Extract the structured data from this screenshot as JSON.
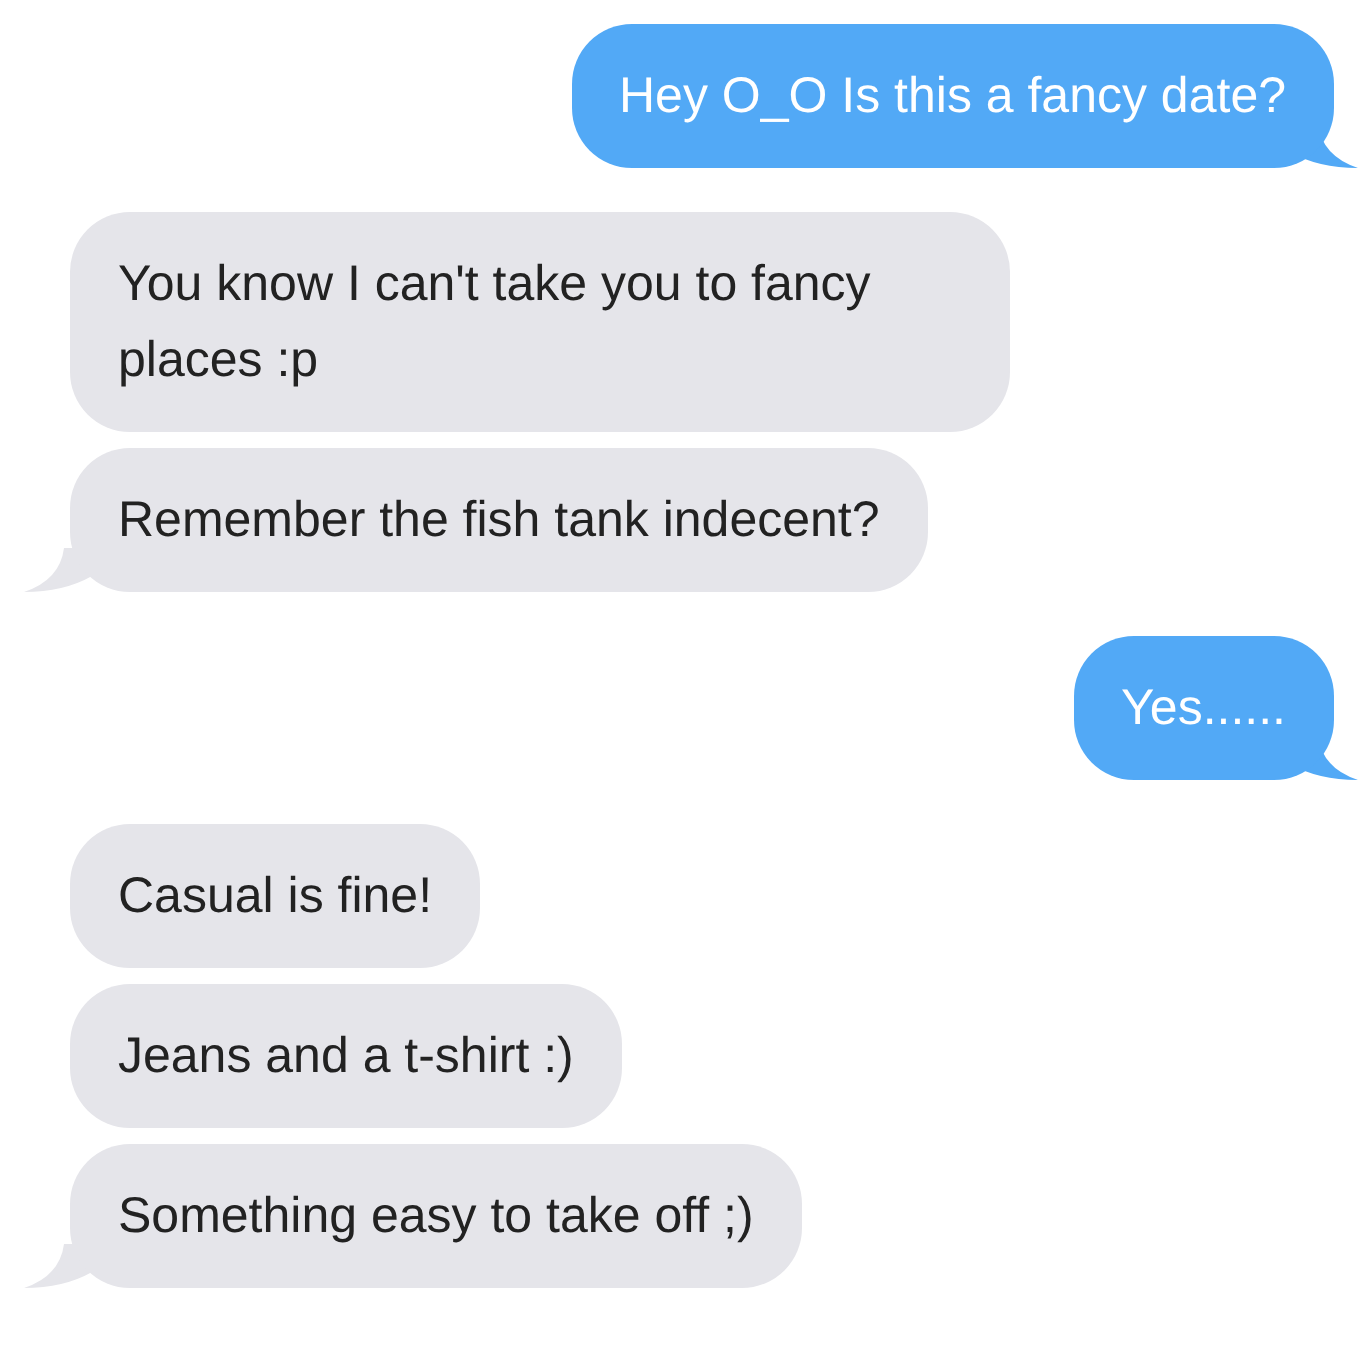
{
  "messages": [
    {
      "kind": "sent",
      "text": "Hey O_O Is this a fancy date?",
      "tail": true
    },
    {
      "kind": "received",
      "text": "You know I can't take you to fancy places :p",
      "tail": false
    },
    {
      "kind": "received",
      "text": "Remember the fish tank indecent?",
      "tail": true
    },
    {
      "kind": "sent",
      "text": "Yes......",
      "tail": true
    },
    {
      "kind": "received",
      "text": "Casual is fine!",
      "tail": false
    },
    {
      "kind": "received",
      "text": "Jeans and a t-shirt :)",
      "tail": false
    },
    {
      "kind": "received",
      "text": "Something easy to take off ;)",
      "tail": true
    }
  ]
}
